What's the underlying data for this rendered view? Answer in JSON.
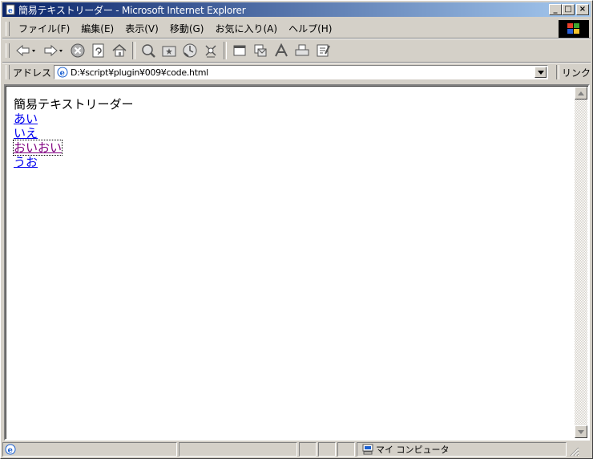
{
  "window": {
    "title": "簡易テキストリーダー - Microsoft Internet Explorer",
    "minimize": "_",
    "maximize": "□",
    "close": "×"
  },
  "menu": {
    "items": [
      {
        "label": "ファイル(F)"
      },
      {
        "label": "編集(E)"
      },
      {
        "label": "表示(V)"
      },
      {
        "label": "移動(G)"
      },
      {
        "label": "お気に入り(A)"
      },
      {
        "label": "ヘルプ(H)"
      }
    ]
  },
  "address": {
    "label": "アドレス",
    "value": "D:¥script¥plugin¥009¥code.html",
    "links_label": "リンク"
  },
  "page": {
    "heading": "簡易テキストリーダー",
    "links": [
      {
        "label": "あい",
        "visited": false
      },
      {
        "label": "いえ",
        "visited": false
      },
      {
        "label": "おいおい",
        "visited": true
      },
      {
        "label": "うお",
        "visited": false
      }
    ]
  },
  "status": {
    "zone_label": "マイ コンピュータ"
  },
  "colors": {
    "titlebar_start": "#0a246a",
    "titlebar_end": "#a6caf0",
    "link": "#0000ee",
    "visited": "#800080",
    "chrome": "#d4d0c8"
  }
}
